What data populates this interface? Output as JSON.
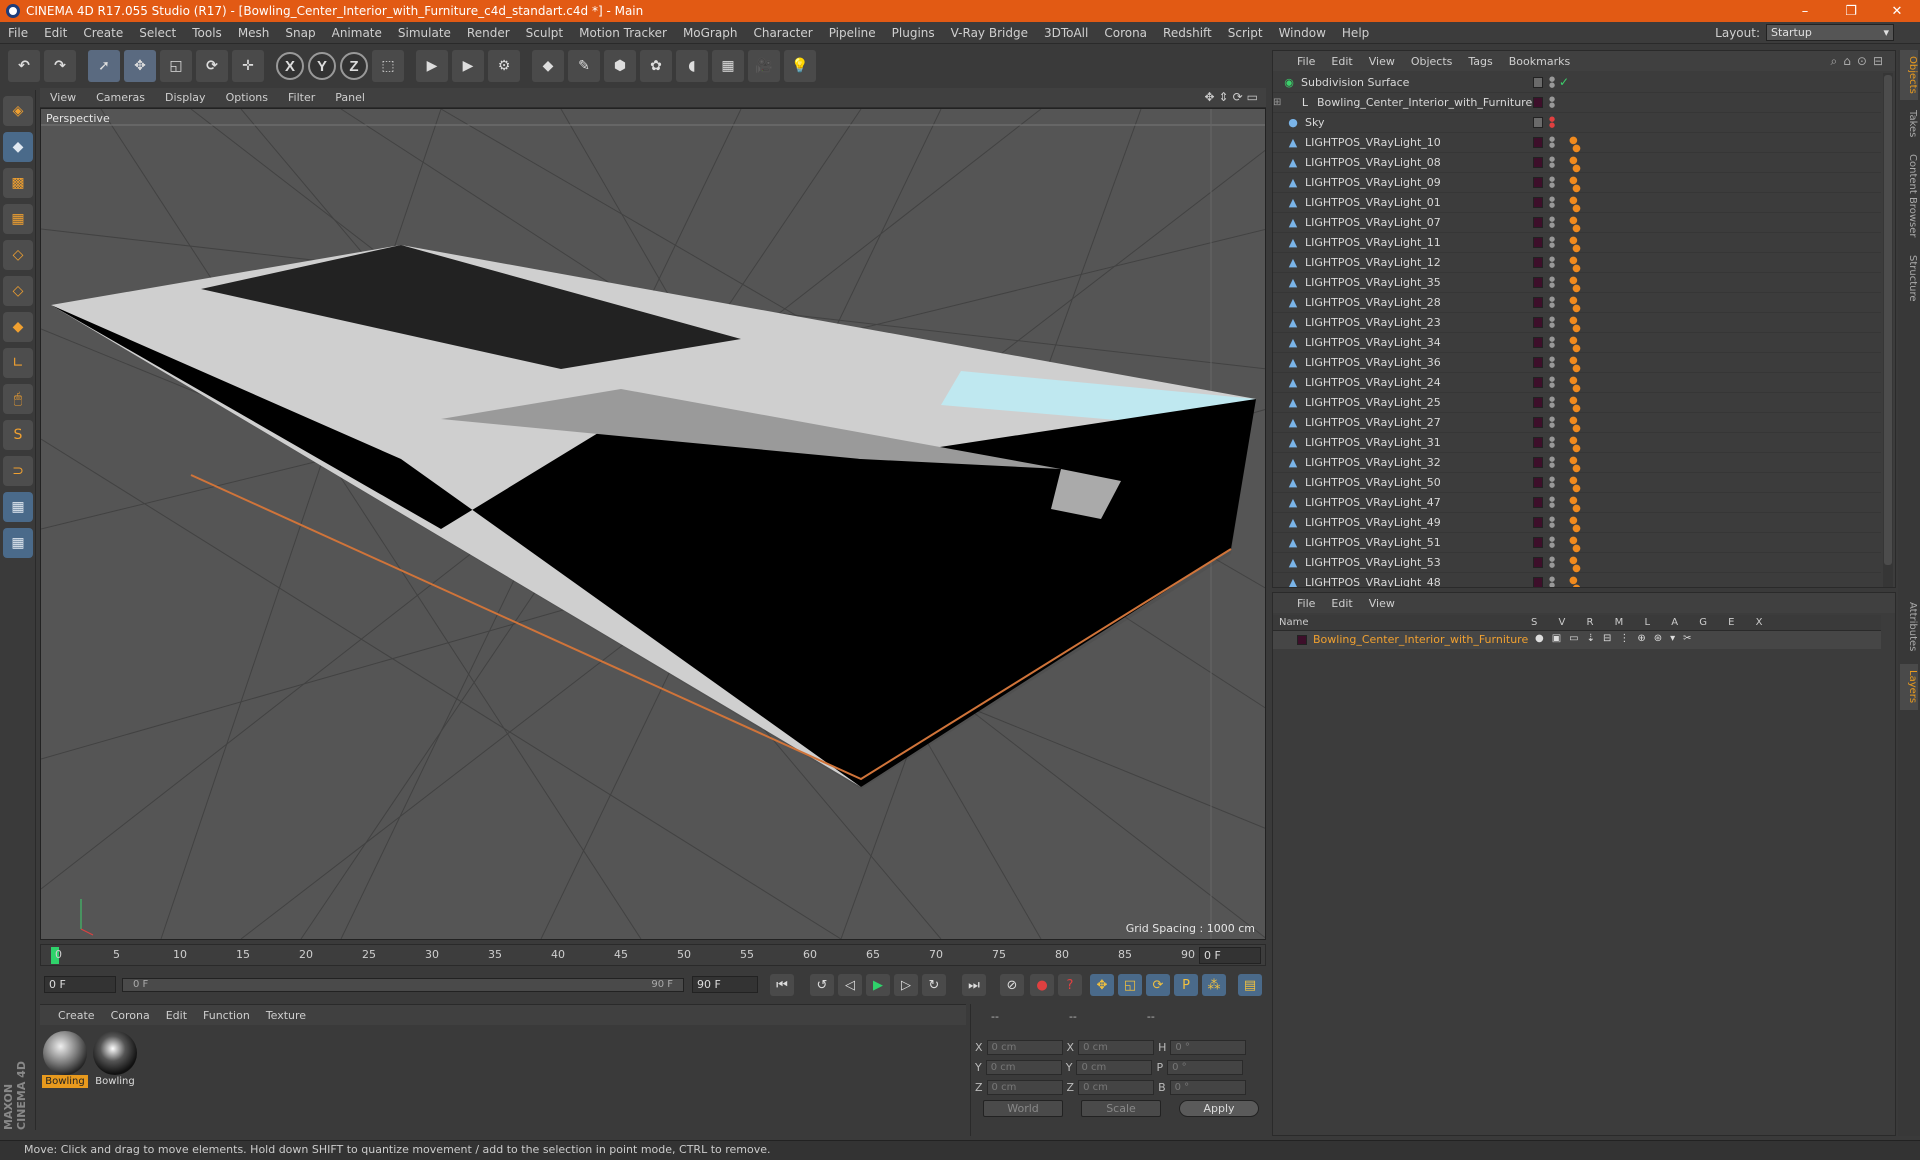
{
  "window": {
    "title": "CINEMA 4D R17.055 Studio (R17) - [Bowling_Center_Interior_with_Furniture_c4d_standart.c4d *] - Main",
    "controls": [
      "–",
      "❐",
      "✕"
    ]
  },
  "menubar": {
    "items": [
      "File",
      "Edit",
      "Create",
      "Select",
      "Tools",
      "Mesh",
      "Snap",
      "Animate",
      "Simulate",
      "Render",
      "Sculpt",
      "Motion Tracker",
      "MoGraph",
      "Character",
      "Pipeline",
      "Plugins",
      "V-Ray Bridge",
      "3DToAll",
      "Corona",
      "Redshift",
      "Script",
      "Window",
      "Help"
    ],
    "layout_label": "Layout:",
    "layout_value": "Startup"
  },
  "toolbar": {
    "axis_x": "X",
    "axis_y": "Y",
    "axis_z": "Z"
  },
  "viewport": {
    "menu": [
      "View",
      "Cameras",
      "Display",
      "Options",
      "Filter",
      "Panel"
    ],
    "label": "Perspective",
    "grid_spacing": "Grid Spacing : 1000 cm"
  },
  "timeline": {
    "ticks": [
      "0",
      "5",
      "10",
      "15",
      "20",
      "25",
      "30",
      "35",
      "40",
      "45",
      "50",
      "55",
      "60",
      "65",
      "70",
      "75",
      "80",
      "85",
      "90"
    ],
    "current_frame_right": "0 F",
    "start_field": "0 F",
    "slider_start": "0 F",
    "slider_end": "90 F",
    "end_field": "90 F"
  },
  "material_manager": {
    "menu": [
      "Create",
      "Corona",
      "Edit",
      "Function",
      "Texture"
    ],
    "materials": [
      {
        "label": "Bowling",
        "selected": true
      },
      {
        "label": "Bowling",
        "selected": false
      }
    ]
  },
  "coordinates": {
    "header": [
      "--",
      "--",
      "--"
    ],
    "rows": [
      {
        "a": "X",
        "av": "0 cm",
        "b": "X",
        "bv": "0 cm",
        "c": "H",
        "cv": "0 °"
      },
      {
        "a": "Y",
        "av": "0 cm",
        "b": "Y",
        "bv": "0 cm",
        "c": "P",
        "cv": "0 °"
      },
      {
        "a": "Z",
        "av": "0 cm",
        "b": "Z",
        "bv": "0 cm",
        "c": "B",
        "cv": "0 °"
      }
    ],
    "world": "World",
    "scale": "Scale",
    "apply": "Apply"
  },
  "object_manager": {
    "menu": [
      "File",
      "Edit",
      "View",
      "Objects",
      "Tags",
      "Bookmarks"
    ],
    "objects": [
      {
        "name": "Subdivision Surface",
        "icon": "subdivision-icon"
      },
      {
        "name": "Bowling_Center_Interior_with_Furniture",
        "icon": "null-icon"
      },
      {
        "name": "Sky",
        "icon": "sky-icon"
      },
      {
        "name": "LIGHTPOS_VRayLight_10",
        "icon": "light-icon"
      },
      {
        "name": "LIGHTPOS_VRayLight_08",
        "icon": "light-icon"
      },
      {
        "name": "LIGHTPOS_VRayLight_09",
        "icon": "light-icon"
      },
      {
        "name": "LIGHTPOS_VRayLight_01",
        "icon": "light-icon"
      },
      {
        "name": "LIGHTPOS_VRayLight_07",
        "icon": "light-icon"
      },
      {
        "name": "LIGHTPOS_VRayLight_11",
        "icon": "light-icon"
      },
      {
        "name": "LIGHTPOS_VRayLight_12",
        "icon": "light-icon"
      },
      {
        "name": "LIGHTPOS_VRayLight_35",
        "icon": "light-icon"
      },
      {
        "name": "LIGHTPOS_VRayLight_28",
        "icon": "light-icon"
      },
      {
        "name": "LIGHTPOS_VRayLight_23",
        "icon": "light-icon"
      },
      {
        "name": "LIGHTPOS_VRayLight_34",
        "icon": "light-icon"
      },
      {
        "name": "LIGHTPOS_VRayLight_36",
        "icon": "light-icon"
      },
      {
        "name": "LIGHTPOS_VRayLight_24",
        "icon": "light-icon"
      },
      {
        "name": "LIGHTPOS_VRayLight_25",
        "icon": "light-icon"
      },
      {
        "name": "LIGHTPOS_VRayLight_27",
        "icon": "light-icon"
      },
      {
        "name": "LIGHTPOS_VRayLight_31",
        "icon": "light-icon"
      },
      {
        "name": "LIGHTPOS_VRayLight_32",
        "icon": "light-icon"
      },
      {
        "name": "LIGHTPOS_VRayLight_50",
        "icon": "light-icon"
      },
      {
        "name": "LIGHTPOS_VRayLight_47",
        "icon": "light-icon"
      },
      {
        "name": "LIGHTPOS_VRayLight_49",
        "icon": "light-icon"
      },
      {
        "name": "LIGHTPOS_VRayLight_51",
        "icon": "light-icon"
      },
      {
        "name": "LIGHTPOS_VRayLight_53",
        "icon": "light-icon"
      },
      {
        "name": "LIGHTPOS_VRayLight_48",
        "icon": "light-icon"
      }
    ]
  },
  "layer_manager": {
    "menu": [
      "File",
      "Edit",
      "View"
    ],
    "col_name": "Name",
    "cols": "S V R M L A G E X",
    "layer": "Bowling_Center_Interior_with_Furniture"
  },
  "side_tabs": [
    "Objects",
    "Takes",
    "Content Browser",
    "Structure",
    "Attributes",
    "Layers"
  ],
  "logo": "MAXON CINEMA 4D",
  "status": "Move: Click and drag to move elements. Hold down SHIFT to quantize movement / add to the selection in point mode, CTRL to remove.",
  "colors": {
    "title_bar": "#e25a14",
    "accent_orange": "#f0a030",
    "layer_swatch": "#3d0f2a"
  }
}
